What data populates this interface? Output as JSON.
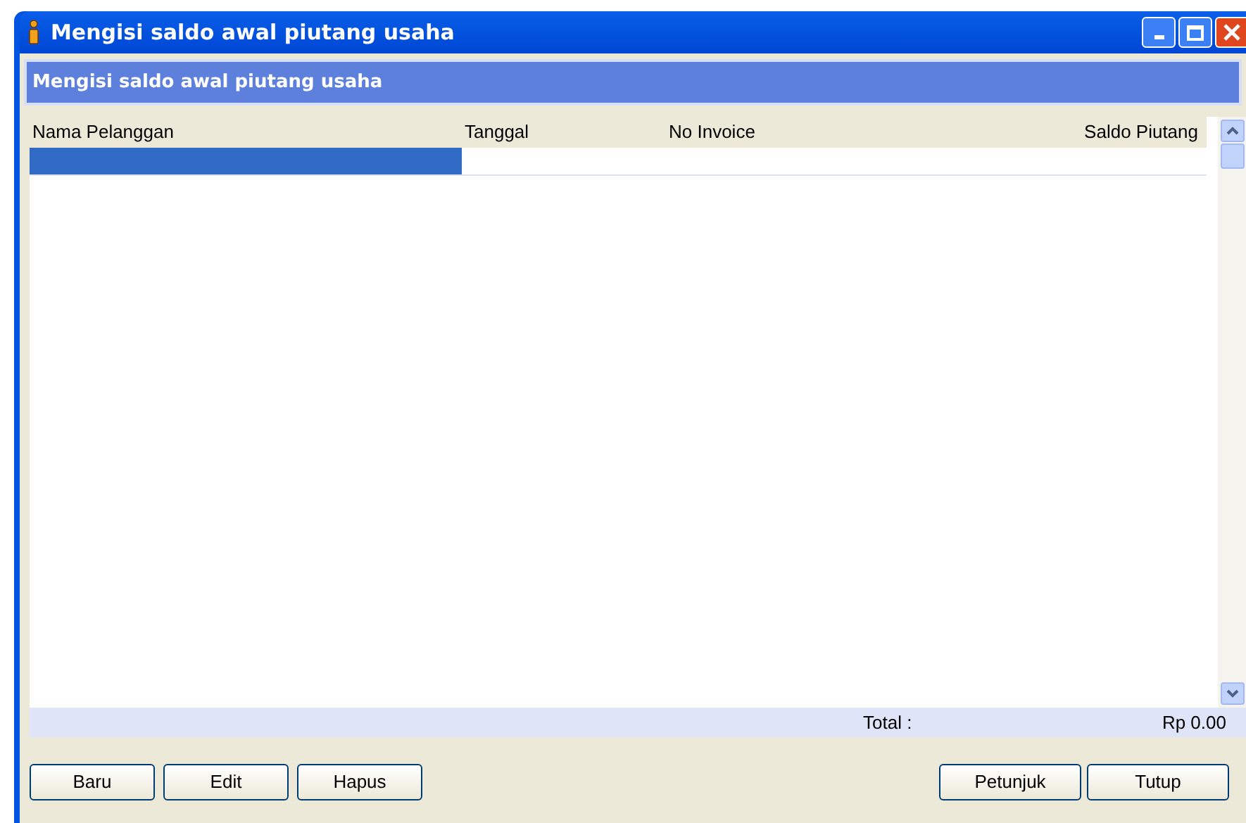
{
  "window": {
    "title": "Mengisi saldo awal piutang usaha"
  },
  "panel": {
    "title": "Mengisi saldo awal piutang usaha"
  },
  "table": {
    "columns": [
      "Nama Pelanggan",
      "Tanggal",
      "No Invoice",
      "Saldo Piutang"
    ],
    "rows": [
      {
        "selected": true
      }
    ]
  },
  "footer": {
    "total_label": "Total :",
    "total_value": "Rp 0.00"
  },
  "buttons_left": [
    "Baru",
    "Edit",
    "Hapus"
  ],
  "buttons_right": [
    "Petunjuk",
    "Tutup"
  ]
}
